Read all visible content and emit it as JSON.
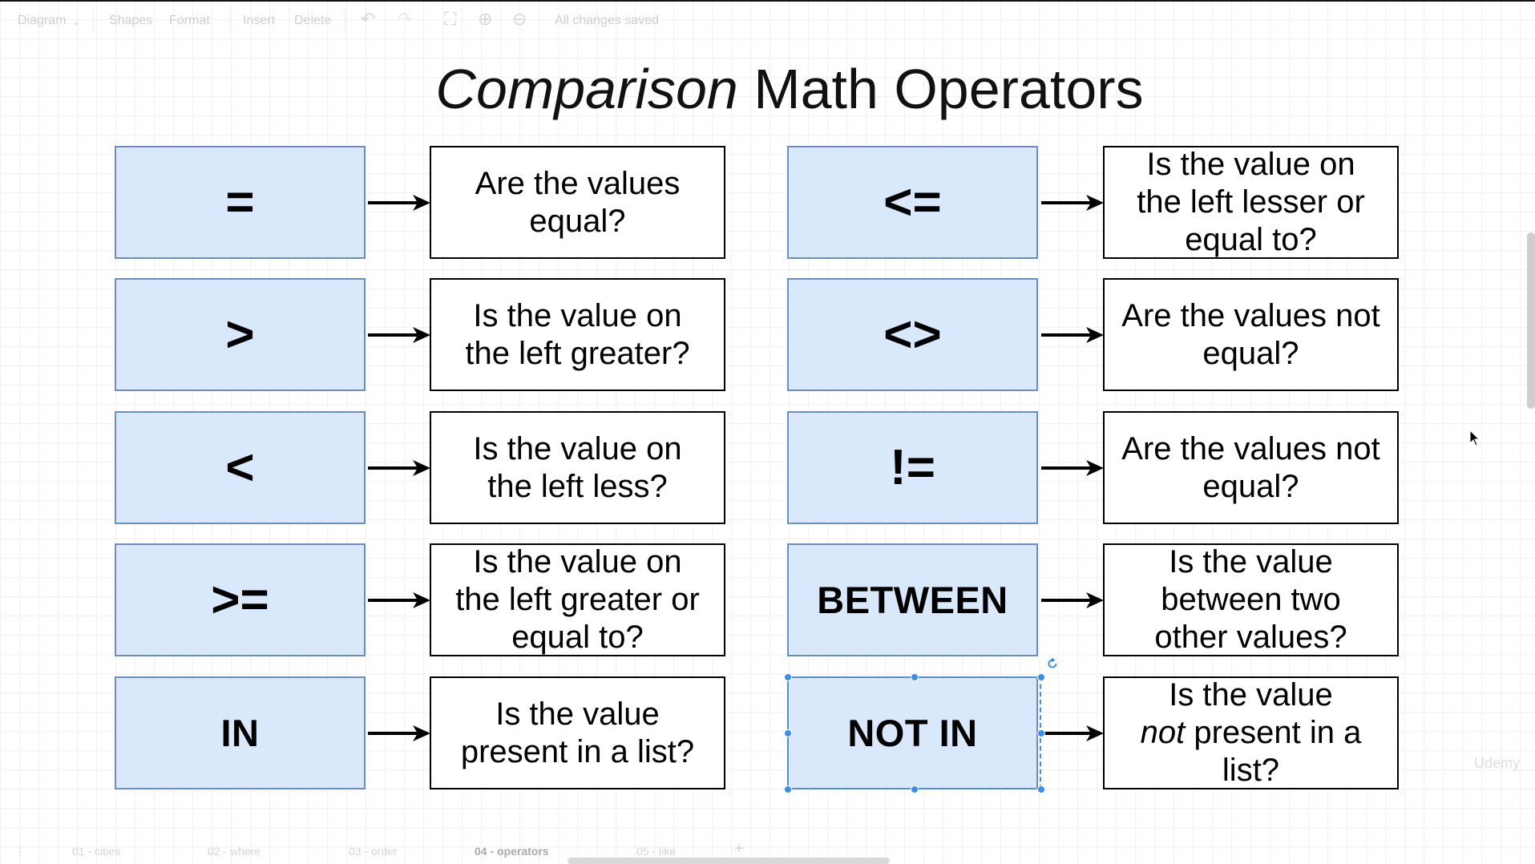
{
  "toolbar": {
    "diagram_menu": "Diagram",
    "shapes": "Shapes",
    "format": "Format",
    "insert": "Insert",
    "delete": "Delete",
    "status": "All changes saved"
  },
  "title": {
    "emphasis": "Comparison",
    "rest": "Math Operators"
  },
  "operators": [
    {
      "symbol": "=",
      "description": [
        "Are the values",
        "equal?"
      ]
    },
    {
      "symbol": ">",
      "description": [
        "Is the value on",
        "the left greater?"
      ]
    },
    {
      "symbol": "<",
      "description": [
        "Is the value on",
        "the left less?"
      ]
    },
    {
      "symbol": ">=",
      "description": [
        "Is the value on",
        "the left greater or",
        "equal to?"
      ]
    },
    {
      "symbol": "IN",
      "description": [
        "Is the value",
        "present in a list?"
      ]
    },
    {
      "symbol": "<=",
      "description": [
        "Is the value on",
        "the left lesser or",
        "equal to?"
      ]
    },
    {
      "symbol": "<>",
      "description": [
        "Are the values not",
        "equal?"
      ]
    },
    {
      "symbol": "!=",
      "description": [
        "Are the values not",
        "equal?"
      ]
    },
    {
      "symbol": "BETWEEN",
      "description": [
        "Is the value",
        "between two",
        "other values?"
      ]
    },
    {
      "symbol": "NOT IN",
      "description_pre_italic": "not",
      "description_line1": "Is the value",
      "description_line2_rest": " present in a",
      "description_line3": "list?",
      "selected": true
    }
  ],
  "tabs": [
    "01 - cities",
    "02 - where",
    "03 - order",
    "04 - operators",
    "05 - like"
  ],
  "active_tab": "04 - operators",
  "watermark": "Udemy",
  "colors": {
    "operator_fill": "#dae8fc",
    "operator_stroke": "#6c8ebf",
    "selection": "#3b8de8"
  }
}
